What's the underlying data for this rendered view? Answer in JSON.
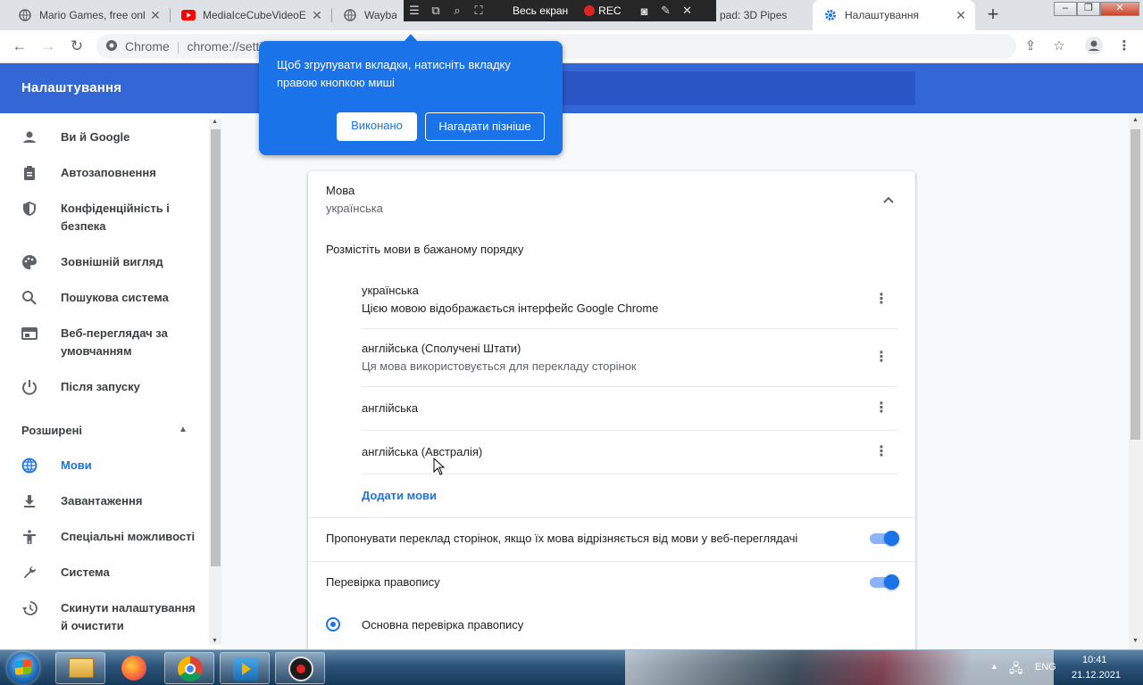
{
  "tabs": [
    {
      "title": "Mario Games, free onl",
      "icon": "globe-icon",
      "active": false
    },
    {
      "title": "MediaIceCubeVideoE",
      "icon": "youtube-icon",
      "active": false
    },
    {
      "title": "Wayback",
      "icon": "globe-icon",
      "active": false
    },
    {
      "title": "pad: 3D Pipes",
      "icon": "globe-icon",
      "active": false
    },
    {
      "title": "Налаштування",
      "icon": "gear-icon",
      "active": true
    }
  ],
  "recorder": {
    "mode_label": "Весь екран",
    "rec_label": "REC"
  },
  "omnibox": {
    "origin": "Chrome",
    "url": "chrome://setti"
  },
  "accent_color": "#1a73e8",
  "header_color": "#3367d6",
  "settings": {
    "title": "Налаштування"
  },
  "sidebar": {
    "items": [
      {
        "label": "Ви й Google",
        "icon": "person-icon"
      },
      {
        "label": "Автозаповнення",
        "icon": "clipboard-icon"
      },
      {
        "label": "Конфіденційність і безпека",
        "icon": "shield-icon"
      },
      {
        "label": "Зовнішній вигляд",
        "icon": "palette-icon"
      },
      {
        "label": "Пошукова система",
        "icon": "search-icon"
      },
      {
        "label": "Веб-переглядач за умовчанням",
        "icon": "browser-icon"
      },
      {
        "label": "Після запуску",
        "icon": "power-icon"
      }
    ],
    "advanced_label": "Розширені",
    "advanced_items": [
      {
        "label": "Мови",
        "icon": "globe-icon",
        "selected": true
      },
      {
        "label": "Завантаження",
        "icon": "download-icon"
      },
      {
        "label": "Спеціальні можливості",
        "icon": "accessibility-icon"
      },
      {
        "label": "Система",
        "icon": "wrench-icon"
      },
      {
        "label": "Скинути налаштування й очистити",
        "icon": "restore-icon"
      }
    ]
  },
  "languages": {
    "section_title": "Мова",
    "section_value": "українська",
    "order_label": "Розмістіть мови в бажаному порядку",
    "list": [
      {
        "name": "українська",
        "note": "Цією мовою відображається інтерфейс Google Chrome"
      },
      {
        "name": "англійська (Сполучені Штати)",
        "note": "Ця мова використовується для перекладу сторінок"
      },
      {
        "name": "англійська",
        "note": ""
      },
      {
        "name": "англійська (Австралія)",
        "note": ""
      }
    ],
    "add_label": "Додати мови",
    "translate_offer_label": "Пропонувати переклад сторінок, якщо їх мова відрізняється від мови у веб-переглядачі",
    "translate_offer_on": true,
    "spellcheck_label": "Перевірка правопису",
    "spellcheck_on": true,
    "spellcheck_basic_label": "Основна перевірка правопису"
  },
  "promo": {
    "text": "Щоб згрупувати вкладки, натисніть вкладку правою кнопкою миші",
    "done_label": "Виконано",
    "later_label": "Нагадати пізніше"
  },
  "taskbar": {
    "lang": "ENG",
    "time": "10:41",
    "date": "21.12.2021",
    "apps": [
      "explorer-icon",
      "firefox-icon",
      "chrome-icon",
      "media-player-icon",
      "recorder-icon"
    ]
  }
}
